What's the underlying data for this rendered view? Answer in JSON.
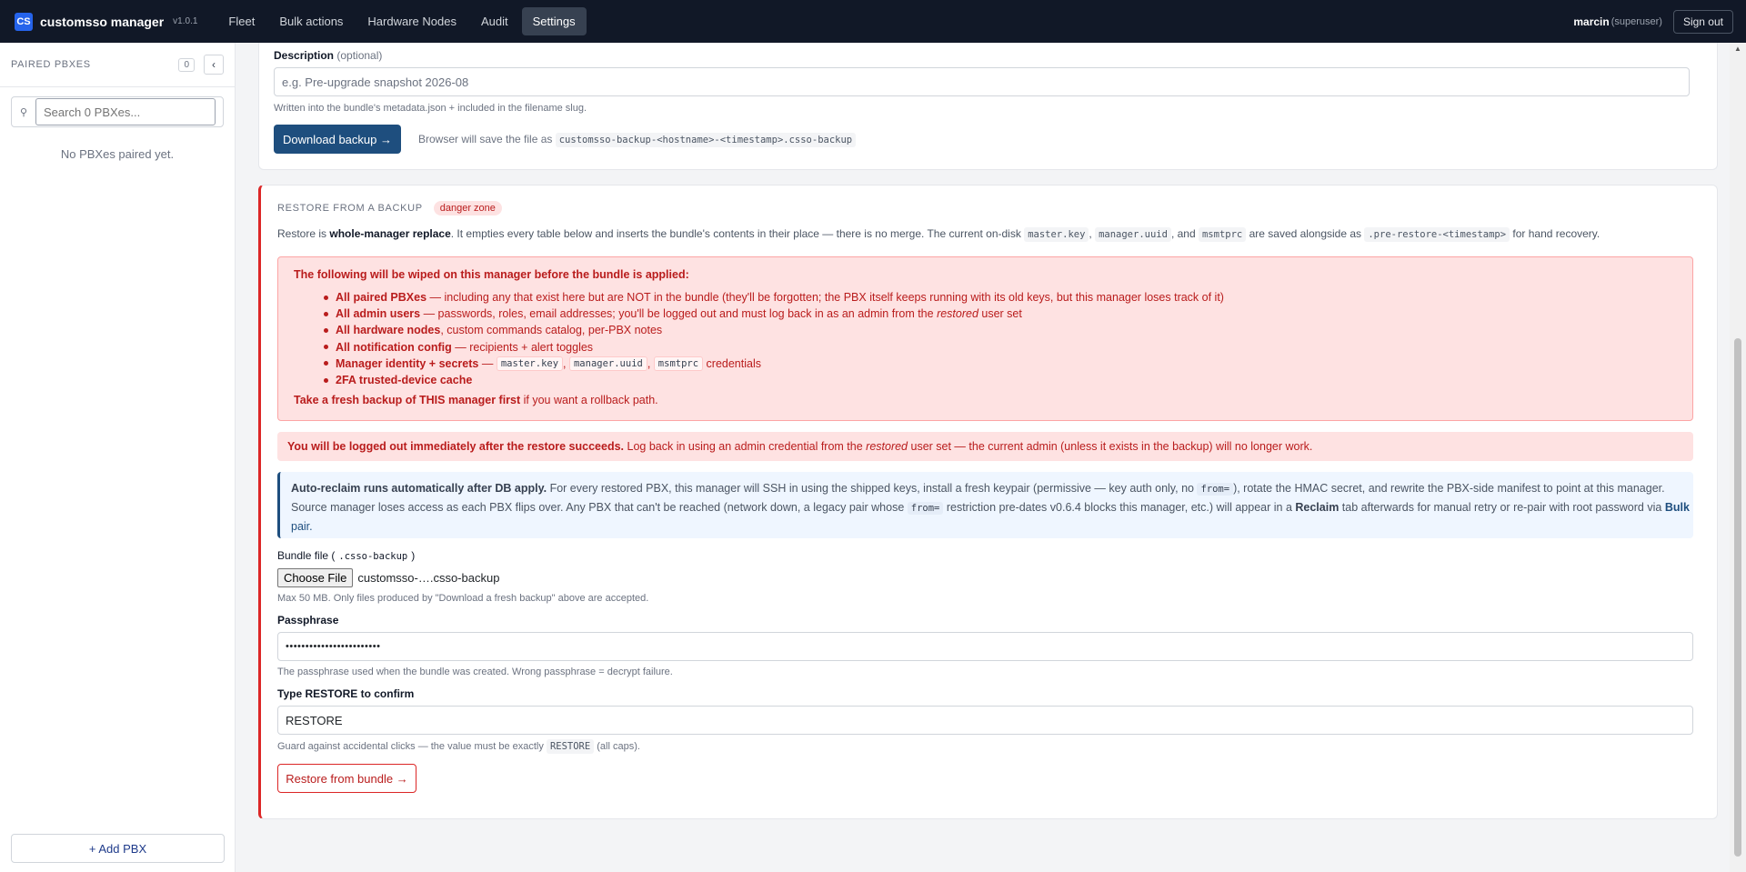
{
  "topnav": {
    "logo": "CS",
    "app_name": "customsso manager",
    "version": "v1.0.1",
    "items": [
      "Fleet",
      "Bulk actions",
      "Hardware Nodes",
      "Audit",
      "Settings"
    ],
    "active": "Settings",
    "user": "marcin",
    "role": "(superuser)",
    "signout": "Sign out"
  },
  "sidebar": {
    "title": "PAIRED PBXES",
    "count": "0",
    "collapse_icon": "‹",
    "search_placeholder": "Search 0 PBXes...",
    "empty": "No PBXes paired yet.",
    "add_button": "+ Add PBX"
  },
  "backup": {
    "desc_label": "Description",
    "desc_optional": "(optional)",
    "desc_placeholder": "e.g. Pre-upgrade snapshot 2026-08",
    "desc_help": "Written into the bundle's metadata.json + included in the filename slug.",
    "download_button": "Download backup →",
    "save_note": "Browser will save the file as",
    "filename": "customsso-backup-<hostname>-<timestamp>.csso-backup"
  },
  "restore": {
    "title": "RESTORE FROM A BACKUP",
    "badge": "danger zone",
    "intro_1": "Restore is",
    "intro_bold": "whole-manager replace",
    "intro_2": ". It empties every table below and inserts the bundle's contents in their place — there is no merge. The current on-disk",
    "code_masterkey": "master.key",
    "code_uuid": "manager.uuid",
    "intro_and": ", and",
    "code_msmtprc": "msmtprc",
    "intro_3": "are saved alongside as",
    "code_prerestore": ".pre-restore-<timestamp>",
    "intro_4": "for hand recovery.",
    "wipe_heading": "The following will be wiped on this manager before the bundle is applied:",
    "wipe_items": [
      {
        "bold": "All paired PBXes",
        "rest": " — including any that exist here but are NOT in the bundle (they'll be forgotten; the PBX itself keeps running with its old keys, but this manager loses track of it)"
      },
      {
        "bold": "All admin users",
        "rest": " — passwords, roles, email addresses; you'll be logged out and must log back in as an admin from the ",
        "italic": "restored",
        "rest2": " user set"
      },
      {
        "bold": "All hardware nodes",
        "rest": ", custom commands catalog, per-PBX notes"
      },
      {
        "bold": "All notification config",
        "rest": " — recipients + alert toggles"
      },
      {
        "bold": "Manager identity + secrets",
        "rest": " — ",
        "codes": [
          "master.key",
          "manager.uuid",
          "msmtprc"
        ],
        "rest2": " credentials"
      },
      {
        "bold": "2FA trusted-device cache",
        "rest": ""
      }
    ],
    "fresh_bold": "Take a fresh backup of THIS manager first",
    "fresh_rest": " if you want a rollback path.",
    "logout_bold": "You will be logged out immediately after the restore succeeds.",
    "logout_rest_1": " Log back in using an admin credential from the ",
    "logout_italic": "restored",
    "logout_rest_2": " user set — the current admin (unless it exists in the backup) will no longer work.",
    "info_bold": "Auto-reclaim runs automatically after DB apply.",
    "info_1": " For every restored PBX, this manager will SSH in using the shipped keys, install a fresh keypair (permissive — key auth only, no ",
    "info_code_from": "from=",
    "info_2": "), rotate the HMAC secret, and rewrite the PBX-side manifest to point at this manager.",
    "info_3": "Source manager loses access as each PBX flips over. Any PBX that can't be reached (network down, a legacy pair whose ",
    "info_code_from2": "from=",
    "info_4": " restriction pre-dates v0.6.4 blocks this manager, etc.) will appear in a ",
    "info_reclaim": "Reclaim",
    "info_5": " tab afterwards for manual retry or re-pair with root password via ",
    "info_bulk": "Bulk",
    "info_6": "pair.",
    "bundle_label": "Bundle file (",
    "bundle_code": ".csso-backup",
    "bundle_label_end": ")",
    "choose_file": "Choose File",
    "file_name": "customsso-….csso-backup",
    "bundle_help": "Max 50 MB. Only files produced by \"Download a fresh backup\" above are accepted.",
    "pass_label": "Passphrase",
    "pass_value": "••••••••••••••••••••••••",
    "pass_help": "The passphrase used when the bundle was created. Wrong passphrase = decrypt failure.",
    "confirm_label": "Type RESTORE to confirm",
    "confirm_value": "RESTORE",
    "confirm_help_1": "Guard against accidental clicks — the value must be exactly",
    "confirm_help_code": "RESTORE",
    "confirm_help_2": "(all caps).",
    "restore_button": "Restore from bundle →"
  }
}
